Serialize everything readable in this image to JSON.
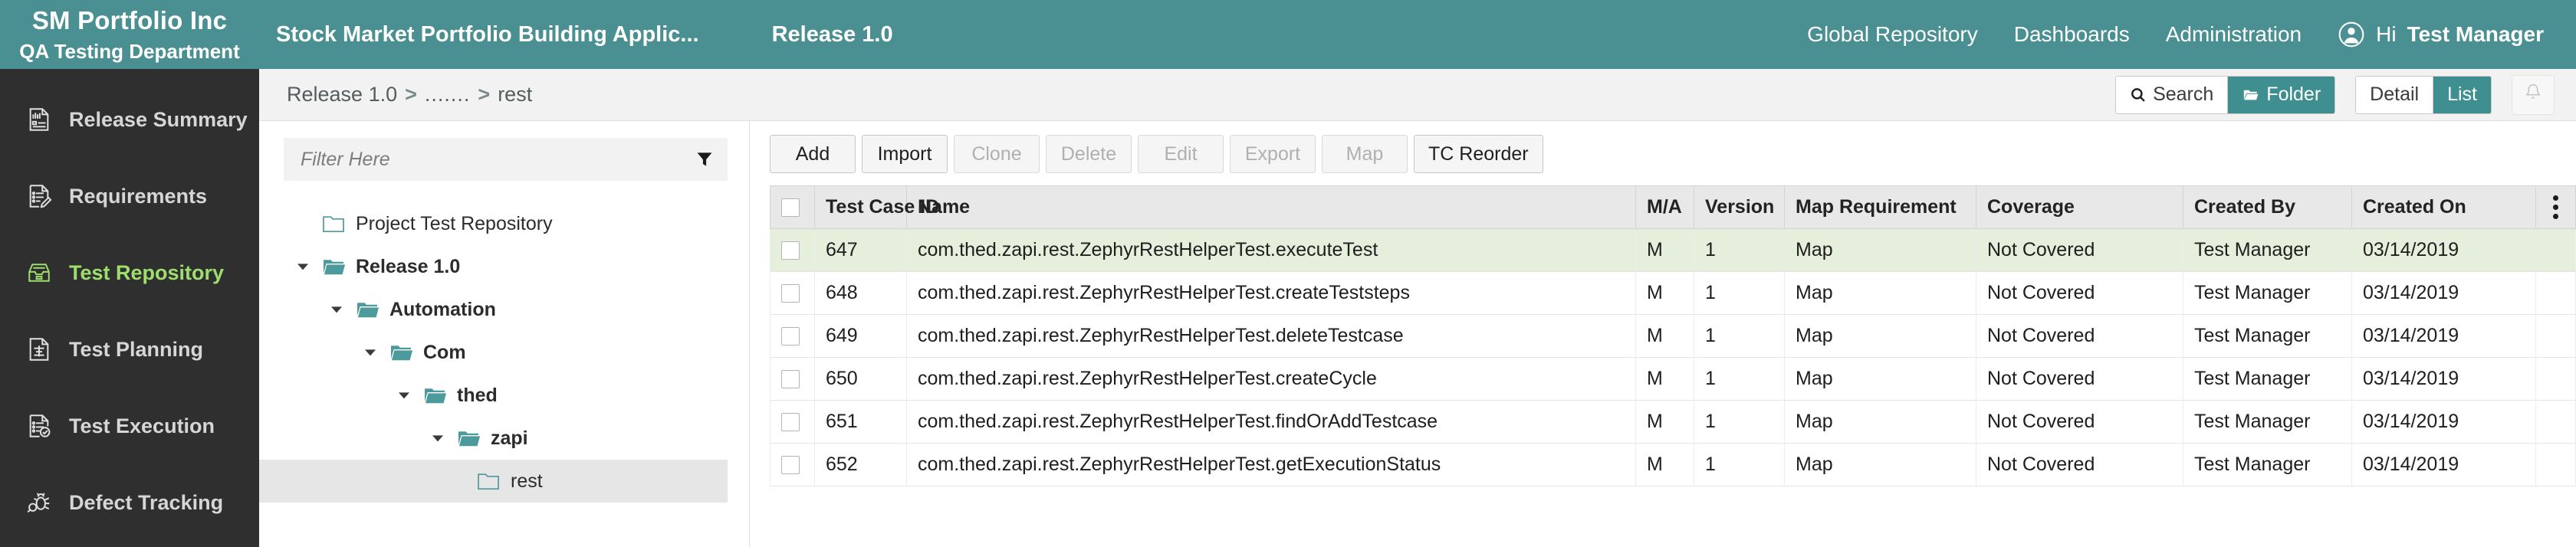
{
  "header": {
    "org_name": "SM Portfolio Inc",
    "org_department": "QA Testing Department",
    "project_name": "Stock Market Portfolio Building Applic...",
    "release_name": "Release 1.0",
    "nav": [
      {
        "label": "Global Repository"
      },
      {
        "label": "Dashboards"
      },
      {
        "label": "Administration"
      }
    ],
    "greeting": "Hi",
    "user_name": "Test Manager",
    "avatar_icon": "user-circle-icon",
    "accent_color": "#4a9092"
  },
  "sidebar": {
    "items": [
      {
        "label": "Release Summary",
        "icon": "document-summary-icon",
        "active": false
      },
      {
        "label": "Requirements",
        "icon": "requirements-pencil-icon",
        "active": false
      },
      {
        "label": "Test Repository",
        "icon": "repository-tray-icon",
        "active": true
      },
      {
        "label": "Test Planning",
        "icon": "planning-document-icon",
        "active": false
      },
      {
        "label": "Test Execution",
        "icon": "execution-check-icon",
        "active": false
      },
      {
        "label": "Defect Tracking",
        "icon": "bug-magnifier-icon",
        "active": false
      }
    ],
    "active_color": "#9ede6d",
    "background_color": "#2f2f2f"
  },
  "breadcrumb": {
    "items": [
      "Release 1.0",
      ".......",
      "rest"
    ],
    "separator": ">"
  },
  "view_controls": {
    "search_label": "Search",
    "search_icon": "magnifier-icon",
    "folder_label": "Folder",
    "folder_icon": "folder-open-icon",
    "folder_active": true,
    "detail_label": "Detail",
    "list_label": "List",
    "list_active": true,
    "bell_icon": "bell-icon",
    "active_color": "#3f8e90"
  },
  "tree": {
    "filter_placeholder": "Filter Here",
    "filter_value": "",
    "filter_icon": "funnel-icon",
    "nodes": [
      {
        "label": "Project Test Repository",
        "depth": 0,
        "caret": "none",
        "folder": "closed",
        "selected": false,
        "bold": false
      },
      {
        "label": "Release 1.0",
        "depth": 0,
        "caret": "expanded",
        "folder": "open",
        "selected": false,
        "bold": true
      },
      {
        "label": "Automation",
        "depth": 1,
        "caret": "expanded",
        "folder": "open",
        "selected": false,
        "bold": true
      },
      {
        "label": "Com",
        "depth": 2,
        "caret": "expanded",
        "folder": "open",
        "selected": false,
        "bold": true
      },
      {
        "label": "thed",
        "depth": 3,
        "caret": "expanded",
        "folder": "open",
        "selected": false,
        "bold": true
      },
      {
        "label": "zapi",
        "depth": 4,
        "caret": "expanded",
        "folder": "open",
        "selected": false,
        "bold": true
      },
      {
        "label": "rest",
        "depth": 5,
        "caret": "none",
        "folder": "closed",
        "selected": true,
        "bold": false
      }
    ]
  },
  "toolbar": {
    "buttons": [
      {
        "label": "Add",
        "enabled": true
      },
      {
        "label": "Import",
        "enabled": true
      },
      {
        "label": "Clone",
        "enabled": false
      },
      {
        "label": "Delete",
        "enabled": false
      },
      {
        "label": "Edit",
        "enabled": false
      },
      {
        "label": "Export",
        "enabled": false
      },
      {
        "label": "Map",
        "enabled": false
      },
      {
        "label": "TC Reorder",
        "enabled": true
      }
    ]
  },
  "grid": {
    "columns": [
      {
        "key": "checkbox",
        "label": ""
      },
      {
        "key": "id",
        "label": "Test Case ID"
      },
      {
        "key": "name",
        "label": "Name"
      },
      {
        "key": "ma",
        "label": "M/A"
      },
      {
        "key": "version",
        "label": "Version"
      },
      {
        "key": "map_requirement",
        "label": "Map Requirement"
      },
      {
        "key": "coverage",
        "label": "Coverage"
      },
      {
        "key": "created_by",
        "label": "Created By"
      },
      {
        "key": "created_on",
        "label": "Created On"
      },
      {
        "key": "menu",
        "label": ""
      }
    ],
    "menu_icon": "kebab-menu-icon",
    "highlight_color": "#e6efdc",
    "link_color": "#2a6ddb",
    "rows": [
      {
        "id": "647",
        "name": "com.thed.zapi.rest.ZephyrRestHelperTest.executeTest",
        "ma": "M",
        "version": "1",
        "map_requirement": "Map",
        "coverage": "Not Covered",
        "created_by": "Test Manager",
        "created_on": "03/14/2019",
        "highlighted": true
      },
      {
        "id": "648",
        "name": "com.thed.zapi.rest.ZephyrRestHelperTest.createTeststeps",
        "ma": "M",
        "version": "1",
        "map_requirement": "Map",
        "coverage": "Not Covered",
        "created_by": "Test Manager",
        "created_on": "03/14/2019",
        "highlighted": false
      },
      {
        "id": "649",
        "name": "com.thed.zapi.rest.ZephyrRestHelperTest.deleteTestcase",
        "ma": "M",
        "version": "1",
        "map_requirement": "Map",
        "coverage": "Not Covered",
        "created_by": "Test Manager",
        "created_on": "03/14/2019",
        "highlighted": false
      },
      {
        "id": "650",
        "name": "com.thed.zapi.rest.ZephyrRestHelperTest.createCycle",
        "ma": "M",
        "version": "1",
        "map_requirement": "Map",
        "coverage": "Not Covered",
        "created_by": "Test Manager",
        "created_on": "03/14/2019",
        "highlighted": false
      },
      {
        "id": "651",
        "name": "com.thed.zapi.rest.ZephyrRestHelperTest.findOrAddTestcase",
        "ma": "M",
        "version": "1",
        "map_requirement": "Map",
        "coverage": "Not Covered",
        "created_by": "Test Manager",
        "created_on": "03/14/2019",
        "highlighted": false
      },
      {
        "id": "652",
        "name": "com.thed.zapi.rest.ZephyrRestHelperTest.getExecutionStatus",
        "ma": "M",
        "version": "1",
        "map_requirement": "Map",
        "coverage": "Not Covered",
        "created_by": "Test Manager",
        "created_on": "03/14/2019",
        "highlighted": false
      }
    ]
  }
}
